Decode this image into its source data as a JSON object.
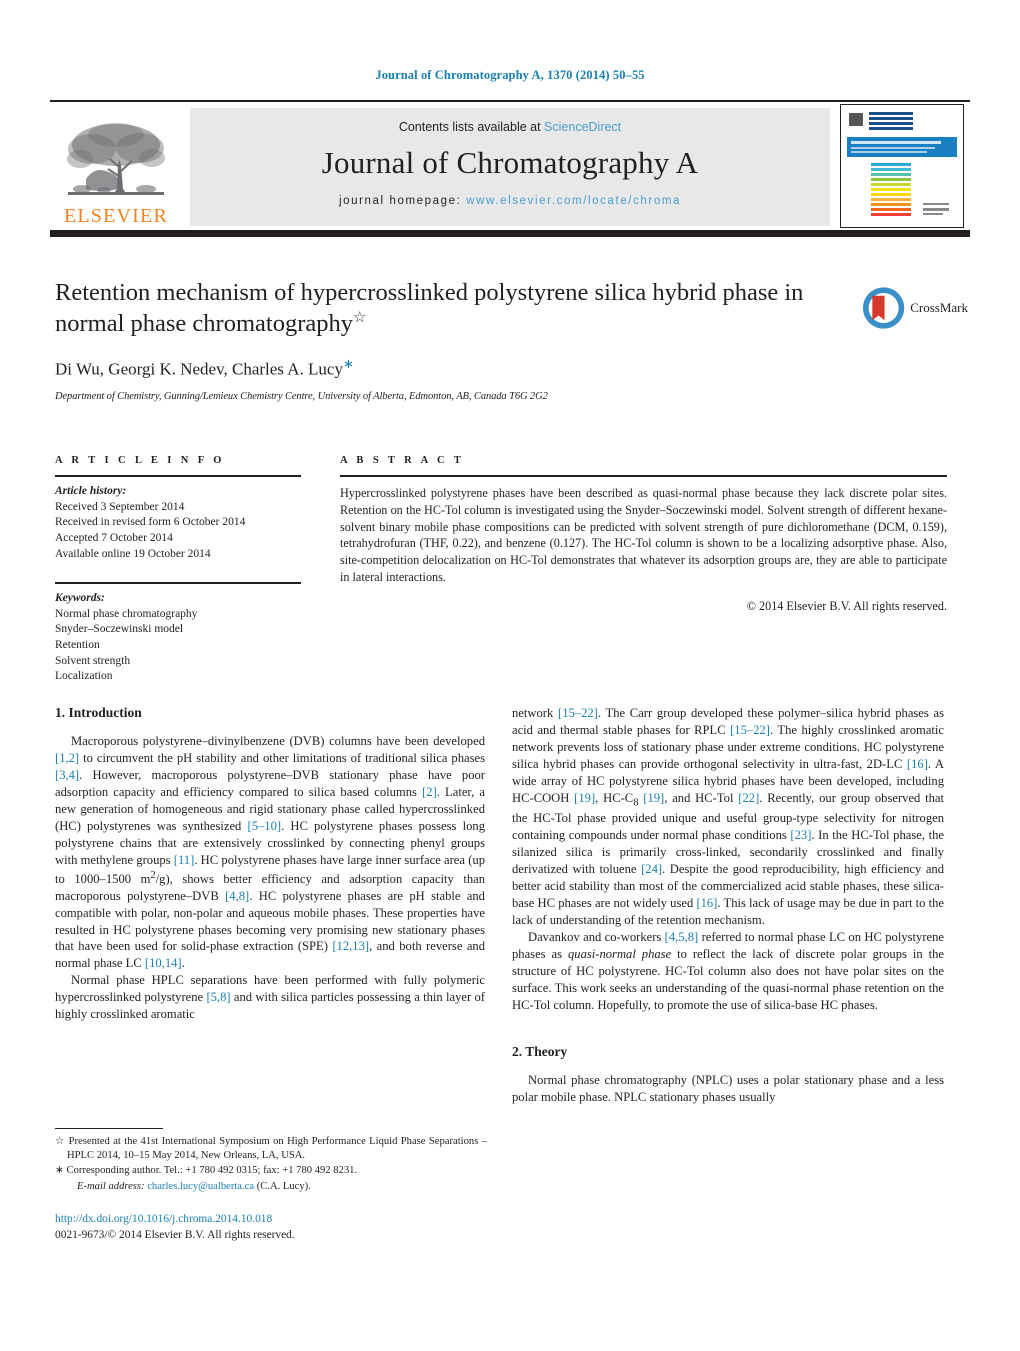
{
  "running_head": "Journal of Chromatography A, 1370 (2014) 50–55",
  "masthead": {
    "contents_prefix": "Contents lists available at ",
    "contents_link": "ScienceDirect",
    "journal_title": "Journal of Chromatography A",
    "homepage_prefix": "journal homepage: ",
    "homepage_url": "www.elsevier.com/locate/chroma",
    "publisher_logo_text": "ELSEVIER",
    "publisher_logo_icon": "elsevier-tree-icon",
    "cover_thumb_icon": "journal-cover-thumbnail"
  },
  "article": {
    "title": "Retention mechanism of hypercrosslinked polystyrene silica hybrid phase in normal phase chromatography",
    "title_footnote_mark": "☆",
    "authors": "Di Wu, Georgi K. Nedev, Charles A. Lucy",
    "corresponding_mark": "∗",
    "affiliation": "Department of Chemistry, Gunning/Lemieux Chemistry Centre, University of Alberta, Edmonton, AB, Canada T6G 2G2",
    "crossmark_label": "CrossMark",
    "crossmark_icon": "crossmark-icon"
  },
  "article_info": {
    "heading": "A R T I C L E   I N F O",
    "history_label": "Article history:",
    "history": [
      "Received 3 September 2014",
      "Received in revised form 6 October 2014",
      "Accepted 7 October 2014",
      "Available online 19 October 2014"
    ],
    "keywords_label": "Keywords:",
    "keywords": [
      "Normal phase chromatography",
      "Snyder–Soczewinski model",
      "Retention",
      "Solvent strength",
      "Localization"
    ]
  },
  "abstract": {
    "heading": "A B S T R A C T",
    "text": "Hypercrosslinked polystyrene phases have been described as quasi-normal phase because they lack discrete polar sites. Retention on the HC-Tol column is investigated using the Snyder–Soczewinski model. Solvent strength of different hexane-solvent binary mobile phase compositions can be predicted with solvent strength of pure dichloromethane (DCM, 0.159), tetrahydrofuran (THF, 0.22), and benzene (0.127). The HC-Tol column is shown to be a localizing adsorptive phase. Also, site-competition delocalization on HC-Tol demonstrates that whatever its adsorption groups are, they are able to participate in lateral interactions.",
    "copyright": "© 2014 Elsevier B.V. All rights reserved."
  },
  "sections": {
    "introduction_heading": "1. Introduction",
    "theory_heading": "2. Theory"
  },
  "body_left": {
    "p1_part1": "Macroporous polystyrene–divinylbenzene (DVB) columns have been developed ",
    "p1_ref1": "[1,2]",
    "p1_part2": " to circumvent the pH stability and other limitations of traditional silica phases ",
    "p1_ref2": "[3,4]",
    "p1_part3": ". However, macroporous polystyrene–DVB stationary phase have poor adsorption capacity and efficiency compared to silica based columns ",
    "p1_ref3": "[2]",
    "p1_part4": ". Later, a new generation of homogeneous and rigid stationary phase called hypercrosslinked (HC) polystyrenes was synthesized ",
    "p1_ref4": "[5–10]",
    "p1_part5": ". HC polystyrene phases possess long polystyrene chains that are extensively crosslinked by connecting phenyl groups with methylene groups ",
    "p1_ref5": "[11]",
    "p1_part6": ". HC polystyrene phases have large inner surface area (up to 1000–1500 m",
    "p1_sup": "2",
    "p1_part7": "/g), shows better efficiency and adsorption capacity than macroporous polystyrene–DVB ",
    "p1_ref6": "[4,8]",
    "p1_part8": ". HC polystyrene phases are pH stable and compatible with polar, non-polar and aqueous mobile phases. These properties have resulted in HC polystyrene phases becoming very promising new stationary phases that have been used for solid-phase extraction (SPE) ",
    "p1_ref7": "[12,13]",
    "p1_part9": ", and both reverse and normal phase LC ",
    "p1_ref8": "[10,14]",
    "p1_part10": ".",
    "p2_part1": "Normal phase HPLC separations have been performed with fully polymeric hypercrosslinked polystyrene ",
    "p2_ref1": "[5,8]",
    "p2_part2": " and with silica particles possessing a thin layer of highly crosslinked aromatic"
  },
  "body_right": {
    "p1_part1": "network ",
    "p1_ref1": "[15–22]",
    "p1_part2": ". The Carr group developed these polymer–silica hybrid phases as acid and thermal stable phases for RPLC ",
    "p1_ref2": "[15–22]",
    "p1_part3": ". The highly crosslinked aromatic network prevents loss of stationary phase under extreme conditions. HC polystyrene silica hybrid phases can provide orthogonal selectivity in ultra-fast, 2D-LC ",
    "p1_ref3": "[16]",
    "p1_part4": ". A wide array of HC polystyrene silica hybrid phases have been developed, including HC-COOH ",
    "p1_ref4": "[19]",
    "p1_part5": ", HC-C",
    "p1_sub": "8",
    "p1_part6": " ",
    "p1_ref5": "[19]",
    "p1_part7": ", and HC-Tol ",
    "p1_ref6": "[22]",
    "p1_part8": ". Recently, our group observed that the HC-Tol phase provided unique and useful group-type selectivity for nitrogen containing compounds under normal phase conditions ",
    "p1_ref7": "[23]",
    "p1_part9": ". In the HC-Tol phase, the silanized silica is primarily cross-linked, secondarily crosslinked and finally derivatized with toluene ",
    "p1_ref8": "[24]",
    "p1_part10": ". Despite the good reproducibility, high efficiency and better acid stability than most of the commercialized acid stable phases, these silica-base HC phases are not widely used ",
    "p1_ref9": "[16]",
    "p1_part11": ". This lack of usage may be due in part to the lack of understanding of the retention mechanism.",
    "p2_part1": "Davankov and co-workers ",
    "p2_ref1": "[4,5,8]",
    "p2_part2": " referred to normal phase LC on HC polystyrene phases as ",
    "p2_ital": "quasi-normal phase",
    "p2_part3": " to reflect the lack of discrete polar groups in the structure of HC polystyrene. HC-Tol column also does not have polar sites on the surface. This work seeks an understanding of the quasi-normal phase retention on the HC-Tol column. Hopefully, to promote the use of silica-base HC phases.",
    "p3": "Normal phase chromatography (NPLC) uses a polar stationary phase and a less polar mobile phase. NPLC stationary phases usually"
  },
  "footnotes": {
    "star_mark": "☆",
    "star_text": "Presented at the 41st International Symposium on High Performance Liquid Phase Separations – HPLC 2014, 10–15 May 2014, New Orleans, LA, USA.",
    "corr_mark": "∗",
    "corr_text": "Corresponding author. Tel.: +1 780 492 0315; fax: +1 780 492 8231.",
    "email_label": "E-mail address:",
    "email": "charles.lucy@ualberta.ca",
    "email_suffix": "(C.A. Lucy)."
  },
  "footer": {
    "doi": "http://dx.doi.org/10.1016/j.chroma.2014.10.018",
    "issn_line": "0021-9673/© 2014 Elsevier B.V. All rights reserved."
  },
  "colors": {
    "link_blue": "#1a7fb5",
    "sd_blue": "#4a9ed1",
    "elsevier_orange": "#f58220",
    "rule_black": "#231f20"
  }
}
